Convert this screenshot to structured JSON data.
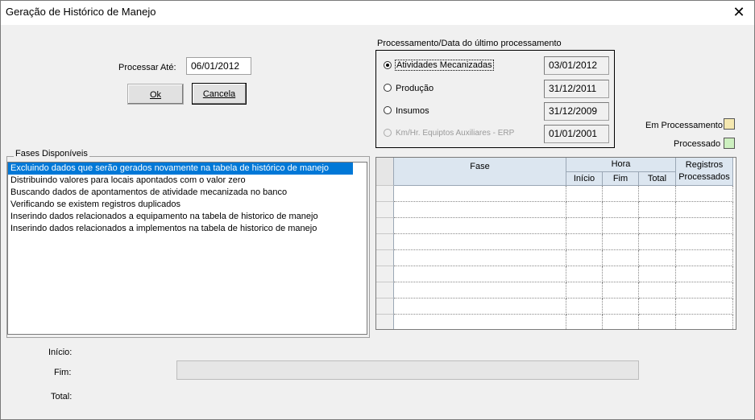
{
  "window": {
    "title": "Geração de Histórico de Manejo",
    "close_glyph": "✕"
  },
  "process_until": {
    "label": "Processar Até:",
    "value": "06/01/2012"
  },
  "buttons": {
    "ok_label": "Ok",
    "cancel_label": "Cancela"
  },
  "last_processing": {
    "group_title": "Processamento/Data do último processamento",
    "options": [
      {
        "label": "Atividades Mecanizadas",
        "date": "03/01/2012",
        "selected": true,
        "enabled": true
      },
      {
        "label": "Produção",
        "date": "31/12/2011",
        "selected": false,
        "enabled": true
      },
      {
        "label": "Insumos",
        "date": "31/12/2009",
        "selected": false,
        "enabled": true
      },
      {
        "label": "Km/Hr. Equiptos Auxiliares - ERP",
        "date": "01/01/2001",
        "selected": false,
        "enabled": false
      }
    ]
  },
  "legend": {
    "in_progress_label": "Em Processamento",
    "in_progress_color": "#f5e8b0",
    "processed_label": "Processado",
    "processed_color": "#cdf0c0"
  },
  "phases": {
    "group_title": "Fases Disponíveis",
    "items": [
      "Excluindo dados que serão gerados novamente na tabela de histórico de manejo",
      "Distribuindo  valores para locais apontados com o valor zero",
      "Buscando dados de apontamentos de atividade mecanizada no banco",
      "Verificando se existem registros duplicados",
      "Inserindo dados relacionados a equipamento na tabela de historico de manejo",
      "Inserindo dados relacionados a implementos na tabela de historico de manejo"
    ],
    "selected_index": 0
  },
  "grid": {
    "col_fase": "Fase",
    "col_hora": "Hora",
    "col_inicio": "Início",
    "col_fim": "Fim",
    "col_total": "Total",
    "col_registros_1": "Registros",
    "col_registros_2": "Processados"
  },
  "footer": {
    "inicio_label": "Início:",
    "fim_label": "Fim:",
    "total_label": "Total:",
    "progress": 0
  },
  "colors": {
    "selection": "#0078d7",
    "grid_header": "#dce6f0"
  }
}
